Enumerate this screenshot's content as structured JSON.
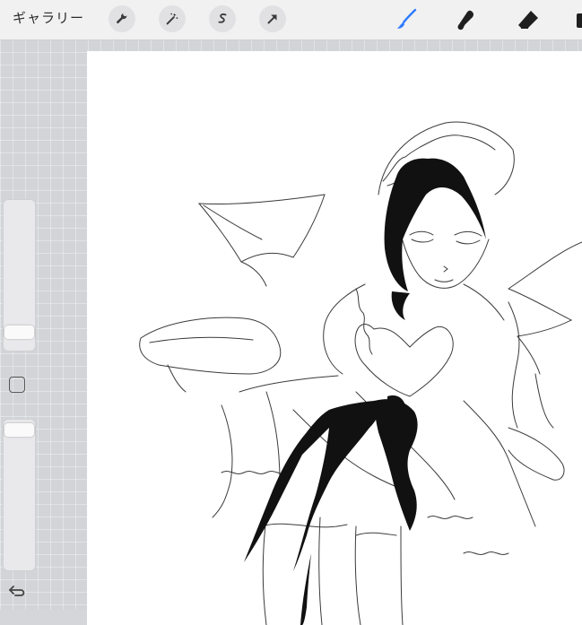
{
  "toolbar": {
    "gallery_label": "ギャラリー",
    "left_tools": [
      "wrench-icon",
      "magic-wand-icon",
      "selection-s-icon",
      "transform-arrow-icon"
    ],
    "right_tools": [
      "brush-icon",
      "smudge-icon",
      "eraser-icon",
      "layers-icon"
    ],
    "active_tool": "brush-icon",
    "accent_color": "#2f7bff"
  },
  "sidebar": {
    "brush_size_level": 0.6,
    "opacity_level": 0.05,
    "modifier_icon": "square-modifier-icon",
    "undo_icon": "undo-icon"
  },
  "canvas": {
    "background": "#ffffff",
    "content": "sketch-illustration"
  }
}
